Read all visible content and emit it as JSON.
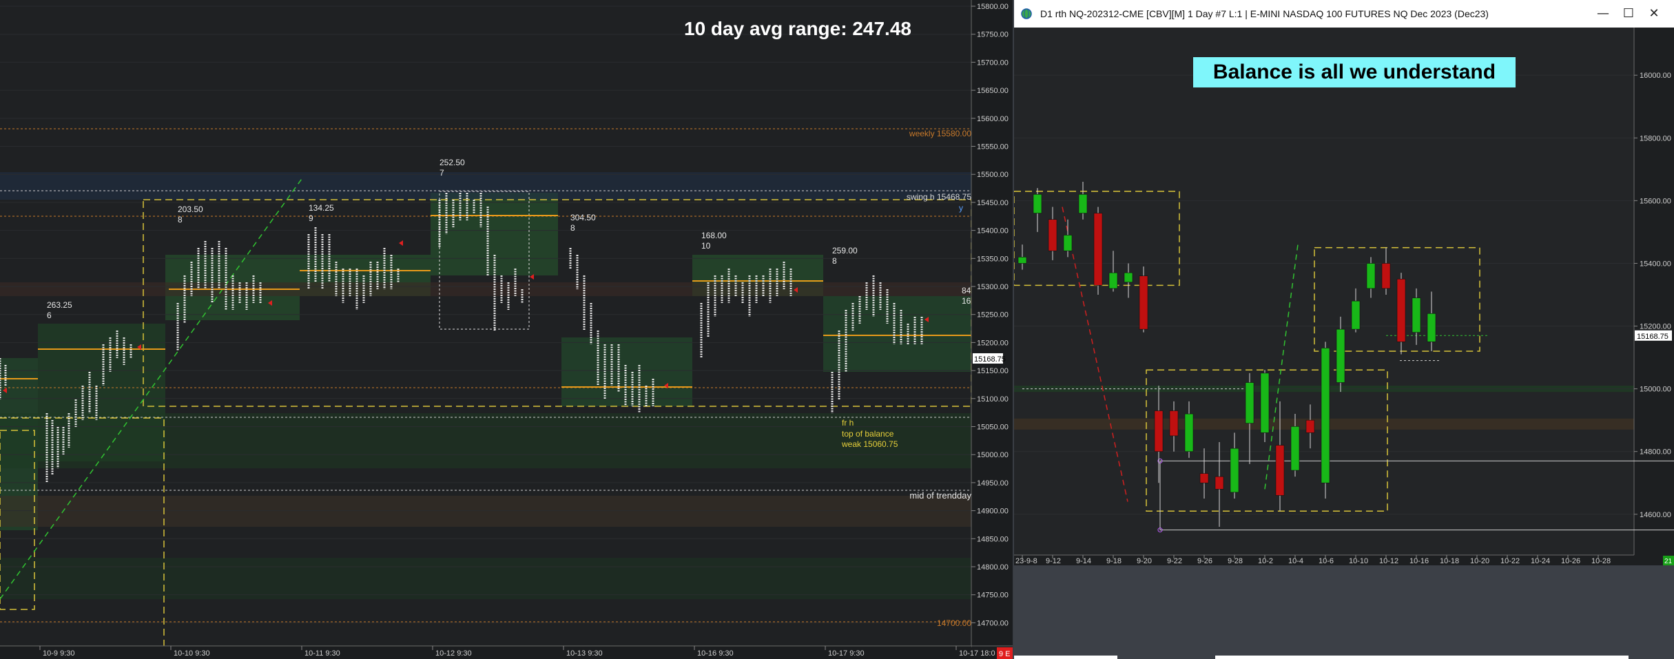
{
  "left": {
    "avg_range_label": "10 day avg range:  247.48",
    "price_ticks": [
      "15800.00",
      "15750.00",
      "15700.00",
      "15650.00",
      "15600.00",
      "15550.00",
      "15500.00",
      "15450.00",
      "15400.00",
      "15350.00",
      "15300.00",
      "15250.00",
      "15200.00",
      "15150.00",
      "15100.00",
      "15050.00",
      "15000.00",
      "14950.00",
      "14900.00",
      "14850.00",
      "14800.00",
      "14750.00",
      "14700.00"
    ],
    "date_ticks": [
      "10-9  9:30",
      "10-10  9:30",
      "10-11  9:30",
      "10-12  9:30",
      "10-13  9:30",
      "10-16  9:30",
      "10-17  9:30",
      "10-17  18:0"
    ],
    "annotations": {
      "weekly": "weekly  15580.00",
      "swing_h": "swing h  15468.75",
      "y_label": "y",
      "mid_trendday": "mid of trendday",
      "level_14700": "14700.00",
      "fr_h": "fr h",
      "top_of_balance": "top of balance",
      "weak": "weak  15060.75",
      "right_84": "84",
      "right_16": "16",
      "current_price": "15168.75",
      "corner_badge": "9 E"
    },
    "sessions": [
      {
        "range": "263.25",
        "count": "6"
      },
      {
        "range": "203.50",
        "count": "8"
      },
      {
        "range": "134.25",
        "count": "9"
      },
      {
        "range": "252.50",
        "count": "7"
      },
      {
        "range": "304.50",
        "count": "8"
      },
      {
        "range": "168.00",
        "count": "10"
      },
      {
        "range": "259.00",
        "count": "8"
      }
    ]
  },
  "right": {
    "title": "D1 rth NQ-202312-CME [CBV][M]  1 Day  #7 L:1 | E-MINI NASDAQ 100 FUTURES NQ Dec 2023 (Dec23)",
    "banner": "Balance is all we understand",
    "price_ticks": [
      "16000.00",
      "15800.00",
      "15600.00",
      "15400.00",
      "15200.00",
      "15000.00",
      "14800.00",
      "14600.00"
    ],
    "current_price": "15168.75",
    "corner_badge": "21",
    "date_ticks": [
      "23-9-8",
      "9-12",
      "9-14",
      "9-18",
      "9-20",
      "9-22",
      "9-26",
      "9-28",
      "10-2",
      "10-4",
      "10-6",
      "10-10",
      "10-12",
      "10-16",
      "10-18",
      "10-20",
      "10-22",
      "10-24",
      "10-26",
      "10-28"
    ],
    "candles": [
      {
        "o": 15400,
        "h": 15460,
        "l": 15380,
        "c": 15420
      },
      {
        "o": 15560,
        "h": 15640,
        "l": 15500,
        "c": 15620
      },
      {
        "o": 15540,
        "h": 15580,
        "l": 15410,
        "c": 15440
      },
      {
        "o": 15440,
        "h": 15540,
        "l": 15420,
        "c": 15490
      },
      {
        "o": 15560,
        "h": 15660,
        "l": 15540,
        "c": 15620
      },
      {
        "o": 15560,
        "h": 15580,
        "l": 15300,
        "c": 15330
      },
      {
        "o": 15320,
        "h": 15440,
        "l": 15310,
        "c": 15370
      },
      {
        "o": 15340,
        "h": 15400,
        "l": 15290,
        "c": 15370
      },
      {
        "o": 15360,
        "h": 15390,
        "l": 15180,
        "c": 15190
      },
      {
        "o": 14930,
        "h": 15010,
        "l": 14700,
        "c": 14800
      },
      {
        "o": 14930,
        "h": 14960,
        "l": 14800,
        "c": 14850
      },
      {
        "o": 14800,
        "h": 14960,
        "l": 14780,
        "c": 14920
      },
      {
        "o": 14730,
        "h": 14810,
        "l": 14650,
        "c": 14700
      },
      {
        "o": 14720,
        "h": 14830,
        "l": 14560,
        "c": 14680
      },
      {
        "o": 14670,
        "h": 14860,
        "l": 14650,
        "c": 14810
      },
      {
        "o": 14890,
        "h": 15050,
        "l": 14760,
        "c": 15020
      },
      {
        "o": 14860,
        "h": 15060,
        "l": 14830,
        "c": 15050
      },
      {
        "o": 14820,
        "h": 14960,
        "l": 14610,
        "c": 14660
      },
      {
        "o": 14740,
        "h": 14920,
        "l": 14720,
        "c": 14880
      },
      {
        "o": 14900,
        "h": 14950,
        "l": 14810,
        "c": 14860
      },
      {
        "o": 14700,
        "h": 15150,
        "l": 14650,
        "c": 15130
      },
      {
        "o": 15020,
        "h": 15230,
        "l": 14990,
        "c": 15190
      },
      {
        "o": 15190,
        "h": 15320,
        "l": 15180,
        "c": 15280
      },
      {
        "o": 15320,
        "h": 15420,
        "l": 15290,
        "c": 15400
      },
      {
        "o": 15400,
        "h": 15450,
        "l": 15300,
        "c": 15320
      },
      {
        "o": 15350,
        "h": 15370,
        "l": 15110,
        "c": 15150
      },
      {
        "o": 15180,
        "h": 15320,
        "l": 15140,
        "c": 15290
      },
      {
        "o": 15150,
        "h": 15310,
        "l": 15120,
        "c": 15240
      }
    ]
  }
}
